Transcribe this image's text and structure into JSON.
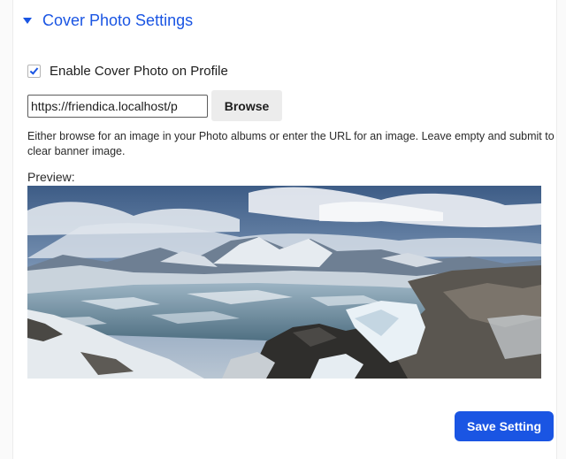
{
  "section": {
    "title": "Cover Photo Settings",
    "expanded": true,
    "icon": "caret-down-icon"
  },
  "enable_cover": {
    "label": "Enable Cover Photo on Profile",
    "checked": true
  },
  "cover_url": {
    "value": "https://friendica.localhost/p"
  },
  "browse": {
    "label": "Browse"
  },
  "help_text": "Either browse for an image in your Photo albums or enter the URL for an image. Leave empty and submit to clear banner image.",
  "preview": {
    "label": "Preview:",
    "image_subject": "polar mountain landscape with frozen lake and cloudy sky"
  },
  "save": {
    "label": "Save Setting"
  },
  "colors": {
    "accent": "#1a55e3",
    "button_gray": "#ececec",
    "text": "#1d1d1d"
  }
}
